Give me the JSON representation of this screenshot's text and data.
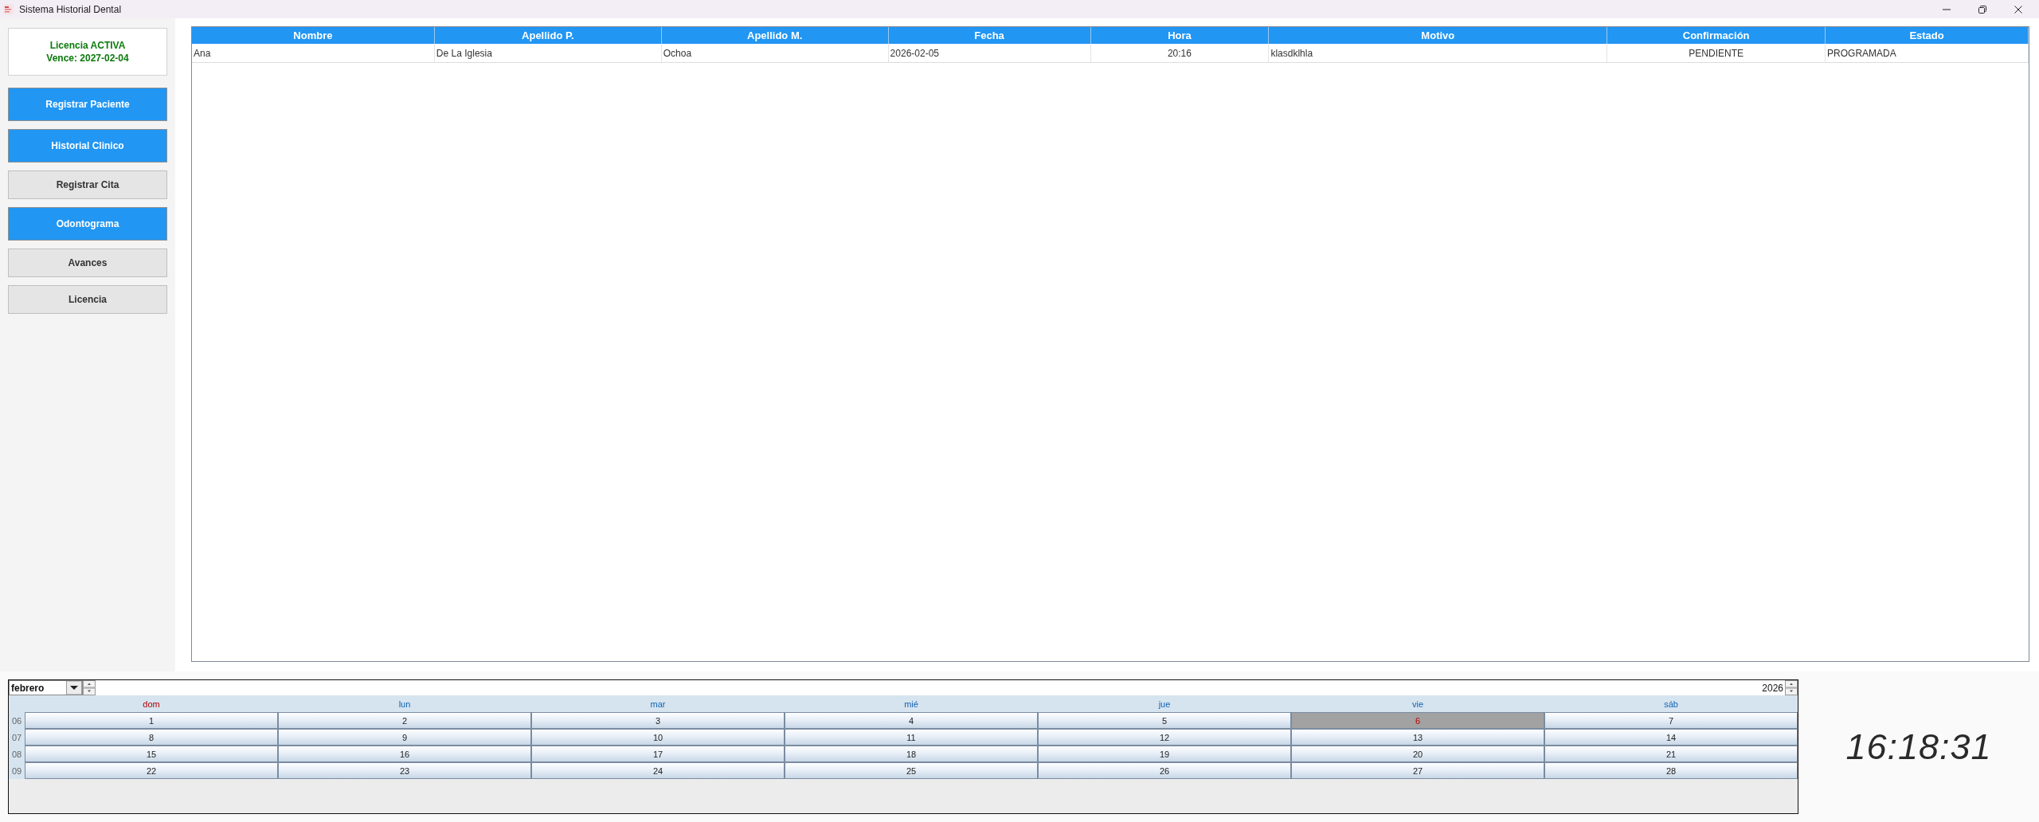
{
  "window": {
    "title": "Sistema Historial Dental"
  },
  "sidebar": {
    "license": {
      "status": "Licencia ACTIVA",
      "expiry": "Vence: 2027-02-04",
      "active": true
    },
    "buttons": [
      {
        "label": "Registrar Paciente",
        "kind": "primary"
      },
      {
        "label": "Historial Clinico",
        "kind": "primary"
      },
      {
        "label": "Registrar Cita",
        "kind": "secondary"
      },
      {
        "label": "Odontograma",
        "kind": "primary"
      },
      {
        "label": "Avances",
        "kind": "secondary"
      },
      {
        "label": "Licencia",
        "kind": "secondary"
      }
    ]
  },
  "table": {
    "columns": [
      {
        "label": "Nombre",
        "kind": "plain"
      },
      {
        "label": "Apellido P.",
        "kind": "plain"
      },
      {
        "label": "Apellido M.",
        "kind": "plain"
      },
      {
        "label": "Fecha",
        "kind": "plain"
      },
      {
        "label": "Hora",
        "kind": "centered"
      },
      {
        "label": "Motivo",
        "kind": "plain"
      },
      {
        "label": "Confirmación",
        "kind": "centered"
      },
      {
        "label": "Estado",
        "kind": "plain"
      }
    ],
    "rows": [
      {
        "cells": [
          "Ana",
          "De La Iglesia",
          "Ochoa",
          "2026-02-05",
          "20:16",
          "klasdklhla",
          "PENDIENTE",
          "PROGRAMADA"
        ]
      }
    ]
  },
  "calendar": {
    "month": "febrero",
    "year": "2026",
    "weekdays": [
      {
        "label": "dom",
        "kind": "sunday"
      },
      {
        "label": "lun",
        "kind": "weekday"
      },
      {
        "label": "mar",
        "kind": "weekday"
      },
      {
        "label": "mié",
        "kind": "weekday"
      },
      {
        "label": "jue",
        "kind": "weekday"
      },
      {
        "label": "vie",
        "kind": "weekday"
      },
      {
        "label": "sáb",
        "kind": "weekday"
      }
    ],
    "weeks": [
      {
        "number": "06",
        "days": [
          {
            "label": "1",
            "selected": false
          },
          {
            "label": "2",
            "selected": false
          },
          {
            "label": "3",
            "selected": false
          },
          {
            "label": "4",
            "selected": false
          },
          {
            "label": "5",
            "selected": false
          },
          {
            "label": "6",
            "selected": true
          },
          {
            "label": "7",
            "selected": false
          }
        ]
      },
      {
        "number": "07",
        "days": [
          {
            "label": "8",
            "selected": false
          },
          {
            "label": "9",
            "selected": false
          },
          {
            "label": "10",
            "selected": false
          },
          {
            "label": "11",
            "selected": false
          },
          {
            "label": "12",
            "selected": false
          },
          {
            "label": "13",
            "selected": false
          },
          {
            "label": "14",
            "selected": false
          }
        ]
      },
      {
        "number": "08",
        "days": [
          {
            "label": "15",
            "selected": false
          },
          {
            "label": "16",
            "selected": false
          },
          {
            "label": "17",
            "selected": false
          },
          {
            "label": "18",
            "selected": false
          },
          {
            "label": "19",
            "selected": false
          },
          {
            "label": "20",
            "selected": false
          },
          {
            "label": "21",
            "selected": false
          }
        ]
      },
      {
        "number": "09",
        "days": [
          {
            "label": "22",
            "selected": false
          },
          {
            "label": "23",
            "selected": false
          },
          {
            "label": "24",
            "selected": false
          },
          {
            "label": "25",
            "selected": false
          },
          {
            "label": "26",
            "selected": false
          },
          {
            "label": "27",
            "selected": false
          },
          {
            "label": "28",
            "selected": false
          }
        ]
      }
    ]
  },
  "clock": {
    "time": "16:18:31"
  }
}
